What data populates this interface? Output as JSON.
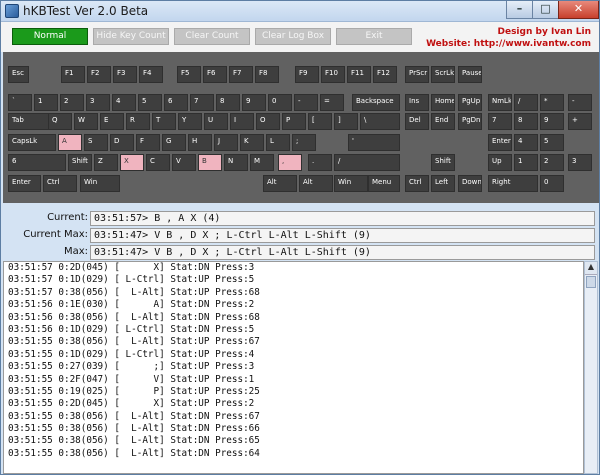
{
  "window": {
    "title": "hKBTest Ver 2.0 Beta",
    "min_glyph": "–",
    "max_glyph": "□",
    "close_glyph": "✕"
  },
  "toolbar": {
    "buttons": [
      "Normal",
      "Hide Key Count",
      "Clear Count",
      "Clear Log Box",
      "Exit"
    ],
    "credit_line1": "Design by Ivan Lin",
    "credit_line2": "Website: http://www.ivantw.com"
  },
  "keyboard": {
    "keys": [
      {
        "label": "Esc",
        "pressed": false
      },
      {
        "label": "F1",
        "pressed": false
      },
      {
        "label": "F2",
        "pressed": false
      },
      {
        "label": "F3",
        "pressed": false
      },
      {
        "label": "F4",
        "pressed": false
      },
      {
        "label": "F5",
        "pressed": false
      },
      {
        "label": "F6",
        "pressed": false
      },
      {
        "label": "F7",
        "pressed": false
      },
      {
        "label": "F8",
        "pressed": false
      },
      {
        "label": "F9",
        "pressed": false
      },
      {
        "label": "F10",
        "pressed": false
      },
      {
        "label": "F11",
        "pressed": false
      },
      {
        "label": "F12",
        "pressed": false
      },
      {
        "label": "PrScr",
        "pressed": false
      },
      {
        "label": "ScrLk",
        "pressed": false
      },
      {
        "label": "Pause",
        "pressed": false
      },
      {
        "label": "`",
        "pressed": false
      },
      {
        "label": "1",
        "pressed": false
      },
      {
        "label": "2",
        "pressed": false
      },
      {
        "label": "3",
        "pressed": false
      },
      {
        "label": "4",
        "pressed": false
      },
      {
        "label": "5",
        "pressed": false
      },
      {
        "label": "6",
        "pressed": false
      },
      {
        "label": "7",
        "pressed": false
      },
      {
        "label": "8",
        "pressed": false
      },
      {
        "label": "9",
        "pressed": false
      },
      {
        "label": "0",
        "pressed": false
      },
      {
        "label": "-",
        "pressed": false
      },
      {
        "label": "=",
        "pressed": false
      },
      {
        "label": "Backspace",
        "pressed": false
      },
      {
        "label": "Ins",
        "pressed": false
      },
      {
        "label": "Home",
        "pressed": false
      },
      {
        "label": "PgUp",
        "pressed": false
      },
      {
        "label": "NmLk",
        "pressed": false
      },
      {
        "label": "/",
        "pressed": false
      },
      {
        "label": "*",
        "pressed": false
      },
      {
        "label": "-",
        "pressed": false
      },
      {
        "label": "Tab",
        "pressed": false
      },
      {
        "label": "Q",
        "pressed": false
      },
      {
        "label": "W",
        "pressed": false
      },
      {
        "label": "E",
        "pressed": false
      },
      {
        "label": "R",
        "pressed": false
      },
      {
        "label": "T",
        "pressed": false
      },
      {
        "label": "Y",
        "pressed": false
      },
      {
        "label": "U",
        "pressed": false
      },
      {
        "label": "I",
        "pressed": false
      },
      {
        "label": "O",
        "pressed": false
      },
      {
        "label": "P",
        "pressed": false
      },
      {
        "label": "[",
        "pressed": false
      },
      {
        "label": "]",
        "pressed": false
      },
      {
        "label": "\\",
        "pressed": false
      },
      {
        "label": "Del",
        "pressed": false
      },
      {
        "label": "End",
        "pressed": false
      },
      {
        "label": "PgDn",
        "pressed": false
      },
      {
        "label": "7",
        "pressed": false
      },
      {
        "label": "8",
        "pressed": false
      },
      {
        "label": "9",
        "pressed": false
      },
      {
        "label": "+",
        "pressed": false
      },
      {
        "label": "CapsLk",
        "pressed": false
      },
      {
        "label": "A",
        "pressed": true
      },
      {
        "label": "S",
        "pressed": false
      },
      {
        "label": "D",
        "pressed": false
      },
      {
        "label": "F",
        "pressed": false
      },
      {
        "label": "G",
        "pressed": false
      },
      {
        "label": "H",
        "pressed": false
      },
      {
        "label": "J",
        "pressed": false
      },
      {
        "label": "K",
        "pressed": false
      },
      {
        "label": "L",
        "pressed": false
      },
      {
        "label": ";",
        "pressed": false
      },
      {
        "label": "'",
        "pressed": false
      },
      {
        "label": "Enter",
        "pressed": false
      },
      {
        "label": "4",
        "pressed": false
      },
      {
        "label": "5",
        "pressed": false
      },
      {
        "label": "6",
        "pressed": false
      },
      {
        "label": "Shift",
        "pressed": false
      },
      {
        "label": "Z",
        "pressed": false
      },
      {
        "label": "X",
        "pressed": true
      },
      {
        "label": "C",
        "pressed": false
      },
      {
        "label": "V",
        "pressed": false
      },
      {
        "label": "B",
        "pressed": true
      },
      {
        "label": "N",
        "pressed": false
      },
      {
        "label": "M",
        "pressed": false
      },
      {
        "label": ",",
        "pressed": true
      },
      {
        "label": ".",
        "pressed": false
      },
      {
        "label": "/",
        "pressed": false
      },
      {
        "label": "Shift",
        "pressed": false
      },
      {
        "label": "Up",
        "pressed": false
      },
      {
        "label": "1",
        "pressed": false
      },
      {
        "label": "2",
        "pressed": false
      },
      {
        "label": "3",
        "pressed": false
      },
      {
        "label": "Enter",
        "pressed": false
      },
      {
        "label": "Ctrl",
        "pressed": false
      },
      {
        "label": "Win",
        "pressed": false
      },
      {
        "label": "Alt",
        "pressed": false
      },
      {
        "label": "Alt",
        "pressed": false
      },
      {
        "label": "Win",
        "pressed": false
      },
      {
        "label": "Menu",
        "pressed": false
      },
      {
        "label": "Ctrl",
        "pressed": false
      },
      {
        "label": "Left",
        "pressed": false
      },
      {
        "label": "Down",
        "pressed": false
      },
      {
        "label": "Right",
        "pressed": false
      },
      {
        "label": "0",
        "pressed": false
      },
      {
        "label": ".",
        "pressed": false
      }
    ]
  },
  "status": {
    "current_label": "Current:",
    "current_value": "03:51:57> B , A X (4)",
    "current_max_label": "Current Max:",
    "current_max_value": "03:51:47> V B , D X ; L-Ctrl L-Alt L-Shift (9)",
    "max_label": "Max:",
    "max_value": "03:51:47> V B , D X ; L-Ctrl L-Alt L-Shift (9)"
  },
  "log": {
    "lines": [
      "03:51:57 0:2D(045) [      X] Stat:DN Press:3",
      "03:51:57 0:1D(029) [ L-Ctrl] Stat:UP Press:5",
      "03:51:57 0:38(056) [  L-Alt] Stat:UP Press:68",
      "03:51:56 0:1E(030) [      A] Stat:DN Press:2",
      "03:51:56 0:38(056) [  L-Alt] Stat:DN Press:68",
      "03:51:56 0:1D(029) [ L-Ctrl] Stat:DN Press:5",
      "03:51:55 0:38(056) [  L-Alt] Stat:UP Press:67",
      "03:51:55 0:1D(029) [ L-Ctrl] Stat:UP Press:4",
      "03:51:55 0:27(039) [      ;] Stat:UP Press:3",
      "03:51:55 0:2F(047) [      V] Stat:UP Press:1",
      "03:51:55 0:19(025) [      P] Stat:UP Press:25",
      "03:51:55 0:2D(045) [      X] Stat:UP Press:2",
      "03:51:55 0:38(056) [  L-Alt] Stat:DN Press:67",
      "03:51:55 0:38(056) [  L-Alt] Stat:DN Press:66",
      "03:51:55 0:38(056) [  L-Alt] Stat:DN Press:65",
      "03:51:55 0:38(056) [  L-Alt] Stat:DN Press:64"
    ]
  },
  "scrollbar": {
    "up_glyph": "▲"
  }
}
